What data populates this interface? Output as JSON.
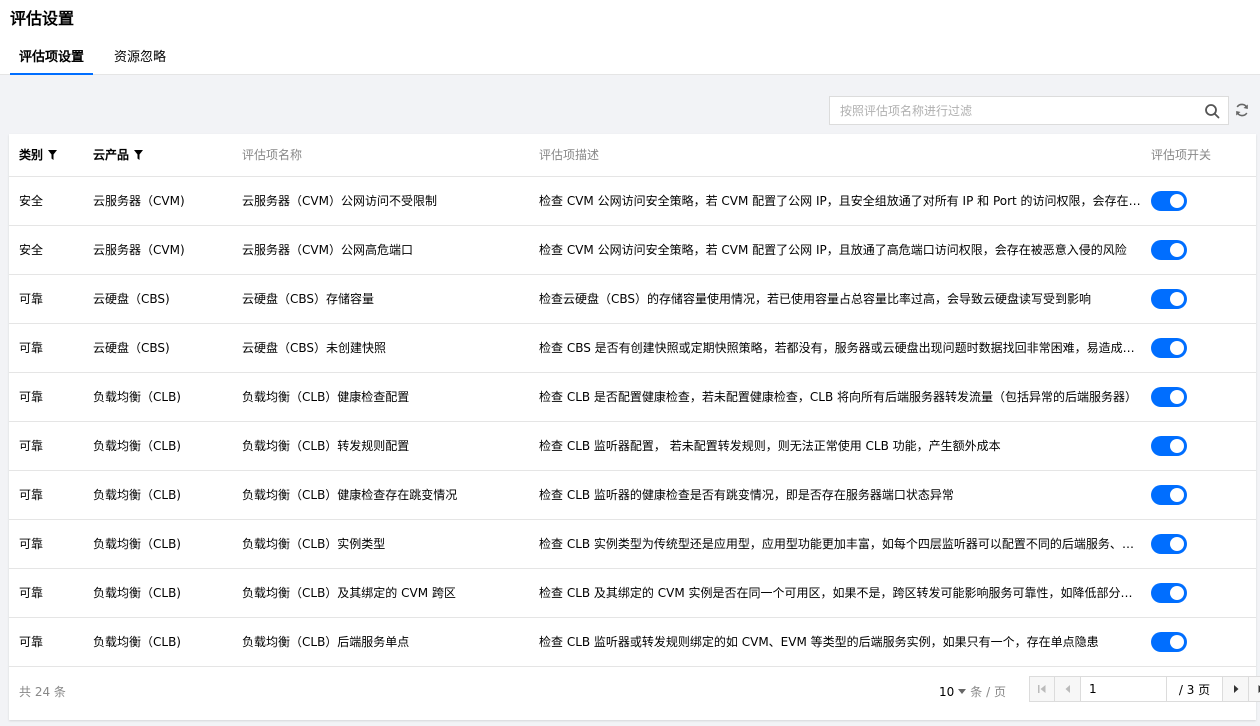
{
  "page": {
    "title": "评估设置"
  },
  "tabs": [
    {
      "label": "评估项设置",
      "active": true
    },
    {
      "label": "资源忽略",
      "active": false
    }
  ],
  "search": {
    "placeholder": "按照评估项名称进行过滤"
  },
  "table": {
    "headers": {
      "category": "类别",
      "product": "云产品",
      "name": "评估项名称",
      "desc": "评估项描述",
      "switch": "评估项开关"
    },
    "rows": [
      {
        "category": "安全",
        "product": "云服务器（CVM)",
        "name": "云服务器（CVM）公网访问不受限制",
        "desc": "检查 CVM 公网访问安全策略，若 CVM 配置了公网 IP，且安全组放通了对所有 IP 和 Port 的访问权限，会存在被恶意入侵的风险",
        "enabled": true
      },
      {
        "category": "安全",
        "product": "云服务器（CVM)",
        "name": "云服务器（CVM）公网高危端口",
        "desc": "检查 CVM 公网访问安全策略，若 CVM 配置了公网 IP，且放通了高危端口访问权限，会存在被恶意入侵的风险",
        "enabled": true
      },
      {
        "category": "可靠",
        "product": "云硬盘（CBS)",
        "name": "云硬盘（CBS）存储容量",
        "desc": "检查云硬盘（CBS）的存储容量使用情况，若已使用容量占总容量比率过高，会导致云硬盘读写受到影响",
        "enabled": true
      },
      {
        "category": "可靠",
        "product": "云硬盘（CBS)",
        "name": "云硬盘（CBS）未创建快照",
        "desc": "检查 CBS 是否有创建快照或定期快照策略，若都没有，服务器或云硬盘出现问题时数据找回非常困难，易造成较大损失",
        "enabled": true
      },
      {
        "category": "可靠",
        "product": "负载均衡（CLB)",
        "name": "负载均衡（CLB）健康检查配置",
        "desc": "检查 CLB 是否配置健康检查，若未配置健康检查，CLB 将向所有后端服务器转发流量（包括异常的后端服务器）",
        "enabled": true
      },
      {
        "category": "可靠",
        "product": "负载均衡（CLB)",
        "name": "负载均衡（CLB）转发规则配置",
        "desc": "检查 CLB 监听器配置， 若未配置转发规则，则无法正常使用 CLB 功能，产生额外成本",
        "enabled": true
      },
      {
        "category": "可靠",
        "product": "负载均衡（CLB)",
        "name": "负载均衡（CLB）健康检查存在跳变情况",
        "desc": "检查 CLB 监听器的健康检查是否有跳变情况，即是否存在服务器端口状态异常",
        "enabled": true
      },
      {
        "category": "可靠",
        "product": "负载均衡（CLB)",
        "name": "负载均衡（CLB）实例类型",
        "desc": "检查 CLB 实例类型为传统型还是应用型，应用型功能更加丰富，如每个四层监听器可以配置不同的后端服务、支持更多协议",
        "enabled": true
      },
      {
        "category": "可靠",
        "product": "负载均衡（CLB)",
        "name": "负载均衡（CLB）及其绑定的 CVM 跨区",
        "desc": "检查 CLB 及其绑定的 CVM 实例是否在同一个可用区，如果不是，跨区转发可能影响服务可靠性，如降低部分转发性能",
        "enabled": true
      },
      {
        "category": "可靠",
        "product": "负载均衡（CLB)",
        "name": "负载均衡（CLB）后端服务单点",
        "desc": "检查 CLB 监听器或转发规则绑定的如 CVM、EVM 等类型的后端服务实例，如果只有一个，存在单点隐患",
        "enabled": true
      }
    ]
  },
  "pagination": {
    "total": "共 24 条",
    "page_size": "10",
    "page_size_unit": "条 / 页",
    "current_page": "1",
    "total_pages": "/ 3 页"
  },
  "colors": {
    "accent": "#006eff"
  },
  "icons": {
    "search": "search-icon",
    "refresh": "refresh-icon",
    "filter": "filter-icon",
    "first": "first-page-icon",
    "prev": "prev-page-icon",
    "next": "next-page-icon",
    "last": "last-page-icon"
  }
}
